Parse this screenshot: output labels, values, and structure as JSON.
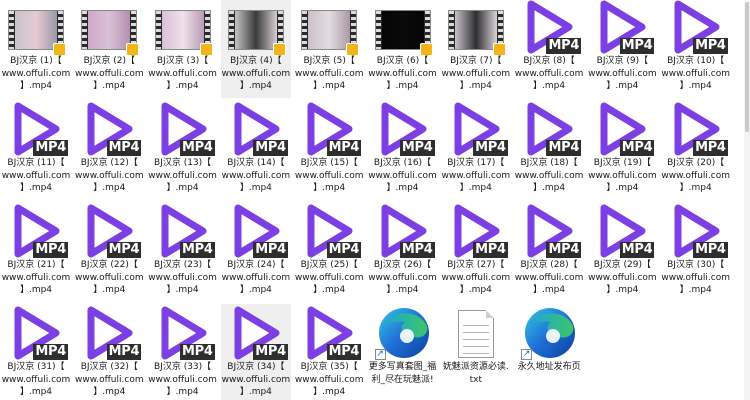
{
  "colors": {
    "play_icon": "#7b3fe4",
    "mp4_tag_bg": "#2e2e2e",
    "selected_tile_bg": "#efefef",
    "edge_icon_blue": "#1f6fd6",
    "edge_icon_green": "#3cc46b"
  },
  "files": [
    {
      "label": "BJ汉京 (1)【\nwww.offuli.com\n】.mp4",
      "icon": "video-thumbnail-icon",
      "thumb_colors": [
        "#c9c3cc",
        "#e7c9d3",
        "#9b9aa8"
      ]
    },
    {
      "label": "BJ汉京 (2)【\nwww.offuli.com\n】.mp4",
      "icon": "video-thumbnail-icon",
      "thumb_colors": [
        "#cfa6c8",
        "#d9c3d6",
        "#b48cb0"
      ]
    },
    {
      "label": "BJ汉京 (3)【\nwww.offuli.com\n】.mp4",
      "icon": "video-thumbnail-icon",
      "thumb_colors": [
        "#d8c0d8",
        "#efe2ea",
        "#b99bb5"
      ]
    },
    {
      "label": "BJ汉京 (4)【\nwww.offuli.com\n】.mp4",
      "icon": "video-thumbnail-icon",
      "thumb_colors": [
        "#c8c2c8",
        "#3a3a3a",
        "#d7cfd3"
      ],
      "selected": true
    },
    {
      "label": "BJ汉京 (5)【\nwww.offuli.com\n】.mp4",
      "icon": "video-thumbnail-icon",
      "thumb_colors": [
        "#cbbfc9",
        "#e5dce2",
        "#a89aa6"
      ]
    },
    {
      "label": "BJ汉京 (6)【\nwww.offuli.com\n】.mp4",
      "icon": "video-thumbnail-icon",
      "thumb_colors": [
        "#050505",
        "#0a0a0a",
        "#050505"
      ]
    },
    {
      "label": "BJ汉京 (7)【\nwww.offuli.com\n】.mp4",
      "icon": "video-thumbnail-icon",
      "thumb_colors": [
        "#c7c1c7",
        "#2f2f33",
        "#d9d1d6"
      ]
    },
    {
      "label": "BJ汉京 (8)【\nwww.offuli.com\n】.mp4",
      "icon": "mp4-play-icon"
    },
    {
      "label": "BJ汉京 (9)【\nwww.offuli.com\n】.mp4",
      "icon": "mp4-play-icon"
    },
    {
      "label": "BJ汉京 (10)【\nwww.offuli.com\n】.mp4",
      "icon": "mp4-play-icon"
    },
    {
      "label": "BJ汉京 (11)【\nwww.offuli.com\n】.mp4",
      "icon": "mp4-play-icon"
    },
    {
      "label": "BJ汉京 (12)【\nwww.offuli.com\n】.mp4",
      "icon": "mp4-play-icon"
    },
    {
      "label": "BJ汉京 (13)【\nwww.offuli.com\n】.mp4",
      "icon": "mp4-play-icon"
    },
    {
      "label": "BJ汉京 (14)【\nwww.offuli.com\n】.mp4",
      "icon": "mp4-play-icon"
    },
    {
      "label": "BJ汉京 (15)【\nwww.offuli.com\n】.mp4",
      "icon": "mp4-play-icon"
    },
    {
      "label": "BJ汉京 (16)【\nwww.offuli.com\n】.mp4",
      "icon": "mp4-play-icon"
    },
    {
      "label": "BJ汉京 (17)【\nwww.offuli.com\n】.mp4",
      "icon": "mp4-play-icon"
    },
    {
      "label": "BJ汉京 (18)【\nwww.offuli.com\n】.mp4",
      "icon": "mp4-play-icon"
    },
    {
      "label": "BJ汉京 (19)【\nwww.offuli.com\n】.mp4",
      "icon": "mp4-play-icon"
    },
    {
      "label": "BJ汉京 (20)【\nwww.offuli.com\n】.mp4",
      "icon": "mp4-play-icon"
    },
    {
      "label": "BJ汉京 (21)【\nwww.offuli.com\n】.mp4",
      "icon": "mp4-play-icon"
    },
    {
      "label": "BJ汉京 (22)【\nwww.offuli.com\n】.mp4",
      "icon": "mp4-play-icon"
    },
    {
      "label": "BJ汉京 (23)【\nwww.offuli.com\n】.mp4",
      "icon": "mp4-play-icon"
    },
    {
      "label": "BJ汉京 (24)【\nwww.offuli.com\n】.mp4",
      "icon": "mp4-play-icon"
    },
    {
      "label": "BJ汉京 (25)【\nwww.offuli.com\n】.mp4",
      "icon": "mp4-play-icon"
    },
    {
      "label": "BJ汉京 (26)【\nwww.offuli.com\n】.mp4",
      "icon": "mp4-play-icon"
    },
    {
      "label": "BJ汉京 (27)【\nwww.offuli.com\n】.mp4",
      "icon": "mp4-play-icon"
    },
    {
      "label": "BJ汉京 (28)【\nwww.offuli.com\n】.mp4",
      "icon": "mp4-play-icon"
    },
    {
      "label": "BJ汉京 (29)【\nwww.offuli.com\n】.mp4",
      "icon": "mp4-play-icon"
    },
    {
      "label": "BJ汉京 (30)【\nwww.offuli.com\n】.mp4",
      "icon": "mp4-play-icon"
    },
    {
      "label": "BJ汉京 (31)【\nwww.offuli.com\n】.mp4",
      "icon": "mp4-play-icon"
    },
    {
      "label": "BJ汉京 (32)【\nwww.offuli.com\n】.mp4",
      "icon": "mp4-play-icon"
    },
    {
      "label": "BJ汉京 (33)【\nwww.offuli.com\n】.mp4",
      "icon": "mp4-play-icon"
    },
    {
      "label": "BJ汉京 (34)【\nwww.offuli.com\n】.mp4",
      "icon": "mp4-play-icon",
      "selected": true
    },
    {
      "label": "BJ汉京 (35)【\nwww.offuli.com\n】.mp4",
      "icon": "mp4-play-icon"
    },
    {
      "label": "更多写真套图_福\n利_尽在玩魅派!",
      "icon": "edge-shortcut-icon"
    },
    {
      "label": "妩魅派资源必读.\ntxt",
      "icon": "text-document-icon"
    },
    {
      "label": "永久地址发布页",
      "icon": "edge-shortcut-icon"
    }
  ],
  "mp4_tag_text": "MP4",
  "shortcut_arrow": "↗"
}
